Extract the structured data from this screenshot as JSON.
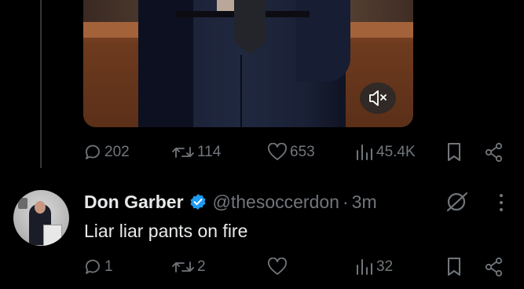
{
  "previous_post": {
    "media": {
      "mute_icon": "speaker-muted-icon"
    },
    "actions": {
      "replies": "202",
      "reposts": "114",
      "likes": "653",
      "views": "45.4K"
    }
  },
  "post": {
    "author_name": "Don Garber",
    "handle": "@thesoccerdon",
    "separator": "·",
    "time": "3m",
    "text": "Liar liar pants on fire",
    "actions": {
      "replies": "1",
      "reposts": "2",
      "likes": "",
      "views": "32"
    }
  },
  "colors": {
    "background": "#000000",
    "text_primary": "#e7e9ea",
    "text_secondary": "#71767b",
    "verified_blue": "#1d9bf0"
  }
}
